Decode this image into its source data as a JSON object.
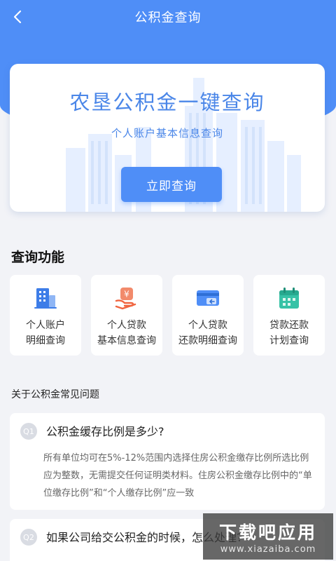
{
  "nav": {
    "title": "公积金查询",
    "back_icon": "chevron-left-icon"
  },
  "hero": {
    "headline": "农垦公积金一键查询",
    "subtitle": "个人账户基本信息查询",
    "button_label": "立即查询"
  },
  "functions": {
    "title": "查询功能",
    "items": [
      {
        "line1": "个人账户",
        "line2": "明细查询",
        "icon": "building-icon"
      },
      {
        "line1": "个人贷款",
        "line2": "基本信息查询",
        "icon": "yuan-coin-icon"
      },
      {
        "line1": "个人贷款",
        "line2": "还款明细查询",
        "icon": "card-return-icon"
      },
      {
        "line1": "贷款还款",
        "line2": "计划查询",
        "icon": "calendar-icon"
      }
    ]
  },
  "faq": {
    "title": "关于公积金常见问题",
    "items": [
      {
        "badge": "Q1",
        "question": "公积金缓存比例是多少?",
        "answer": "所有单位均可在5%-12%范围内选择住房公积金缴存比例所选比例应为整数，无需提交任何证明类材料。住房公积金缴存比例中的“单位缴存比例”和“个人缴存比例”应一致"
      },
      {
        "badge": "Q2",
        "question": "如果公司给交公积金的时候，怎么处理?",
        "answer": ""
      }
    ]
  },
  "watermark": {
    "line1": "下载吧应用",
    "line2": "www.xiazaiba.com"
  },
  "colors": {
    "primary": "#4f8ef7",
    "background": "#f2f3f7",
    "headline": "#4a86e8"
  }
}
